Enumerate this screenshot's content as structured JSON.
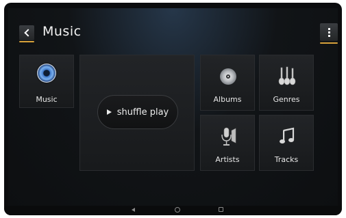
{
  "header": {
    "title": "Music"
  },
  "library": {
    "label": "Music"
  },
  "shuffle": {
    "label": "shuffle play"
  },
  "categories": [
    {
      "label": "Albums",
      "icon": "cd-icon"
    },
    {
      "label": "Genres",
      "icon": "guitars-icon"
    },
    {
      "label": "Artists",
      "icon": "microphone-icon"
    },
    {
      "label": "Tracks",
      "icon": "music-note-icon"
    }
  ],
  "colors": {
    "accent": "#d8a23b"
  }
}
